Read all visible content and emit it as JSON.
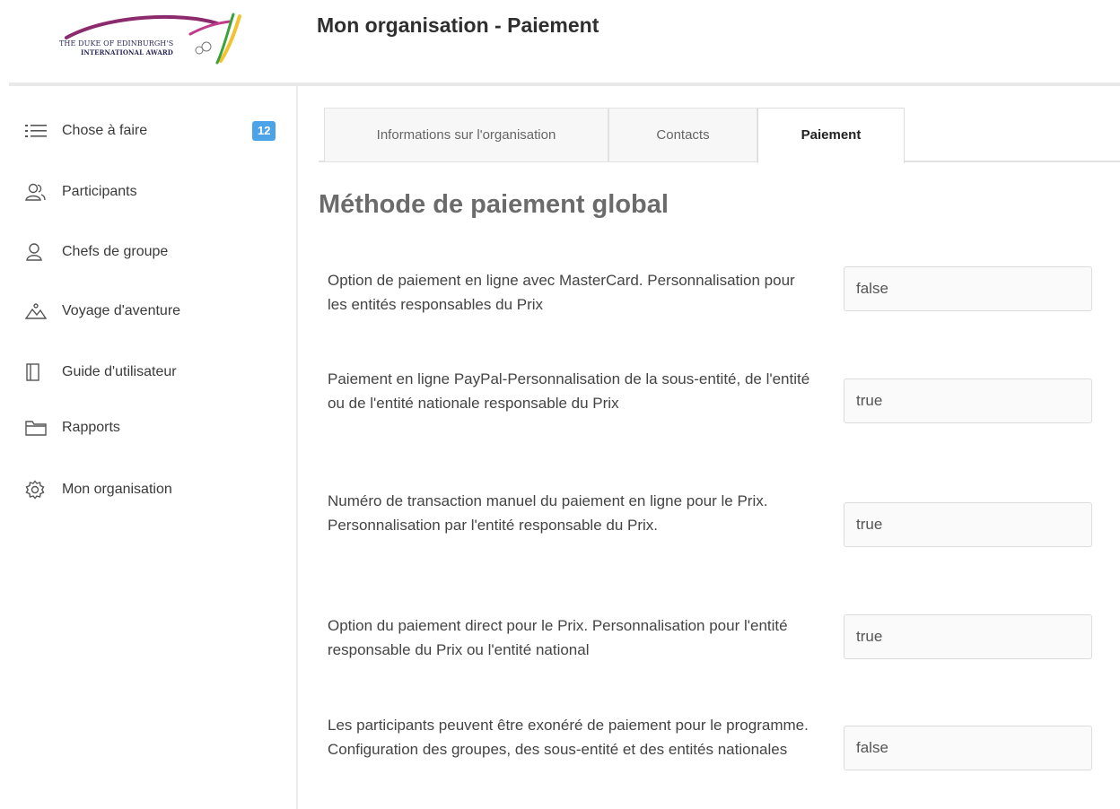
{
  "header": {
    "logo_line1": "THE DUKE OF EDINBURGH'S",
    "logo_line2": "INTERNATIONAL AWARD",
    "title": "Mon organisation - Paiement"
  },
  "sidebar": {
    "items": [
      {
        "label": "Chose à faire",
        "icon": "list-icon",
        "badge": "12"
      },
      {
        "label": "Participants",
        "icon": "participants-icon"
      },
      {
        "label": "Chefs de groupe",
        "icon": "group-leader-icon"
      },
      {
        "label": "Voyage d'aventure",
        "icon": "mountains-icon"
      },
      {
        "label": "Guide d'utilisateur",
        "icon": "book-icon"
      },
      {
        "label": "Rapports",
        "icon": "folder-icon"
      },
      {
        "label": "Mon organisation",
        "icon": "gear-icon"
      }
    ]
  },
  "tabs": [
    {
      "label": "Informations sur l'organisation",
      "active": false
    },
    {
      "label": "Contacts",
      "active": false
    },
    {
      "label": "Paiement",
      "active": true
    }
  ],
  "section": {
    "title": "Méthode de paiement global",
    "settings": [
      {
        "label": "Option de paiement en ligne avec MasterCard. Personnalisation pour les entités responsables du Prix",
        "value": "false"
      },
      {
        "label": "Paiement en ligne PayPal-Personnalisation de la sous-entité, de l'entité ou de l'entité nationale responsable du Prix",
        "value": "true"
      },
      {
        "label": "Numéro de transaction manuel du paiement en ligne pour le Prix. Personnalisation par l'entité responsable du Prix.",
        "value": "true"
      },
      {
        "label": "Option du paiement direct pour le Prix. Personnalisation pour l'entité responsable du Prix ou l'entité national",
        "value": "true"
      },
      {
        "label": "Les participants peuvent être exonéré de paiement pour le programme. Configuration des groupes, des sous-entité et des entités nationales",
        "value": "false"
      }
    ]
  },
  "colors": {
    "badge": "#4da3e8",
    "logo_purple": "#8c2a6e",
    "logo_green": "#3aa23a",
    "logo_yellow": "#f2c230"
  }
}
